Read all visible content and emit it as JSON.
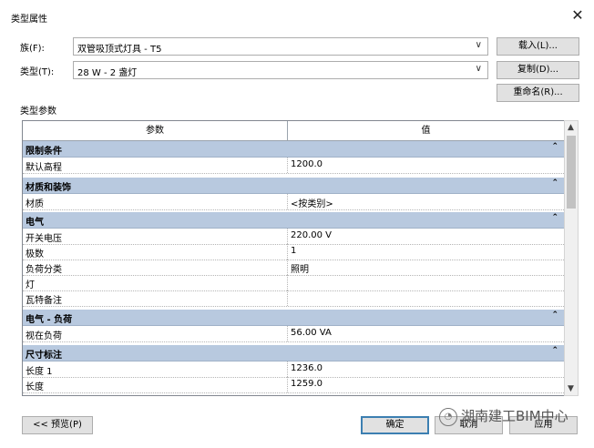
{
  "window": {
    "title": "类型属性",
    "close_glyph": "✕"
  },
  "family": {
    "label": "族(F):",
    "value": "双管吸顶式灯具 - T5",
    "load_button": "载入(L)..."
  },
  "type": {
    "label": "类型(T):",
    "value": "28 W - 2 盏灯",
    "duplicate_button": "复制(D)...",
    "rename_button": "重命名(R)..."
  },
  "section_title": "类型参数",
  "grid": {
    "col_param": "参数",
    "col_value": "值",
    "groups": [
      {
        "name": "限制条件",
        "rows": [
          {
            "param": "默认高程",
            "value": "1200.0"
          }
        ]
      },
      {
        "name": "材质和装饰",
        "rows": [
          {
            "param": "材质",
            "value": "<按类别>"
          }
        ]
      },
      {
        "name": "电气",
        "rows": [
          {
            "param": "开关电压",
            "value": "220.00 V"
          },
          {
            "param": "极数",
            "value": "1"
          },
          {
            "param": "负荷分类",
            "value": "照明"
          },
          {
            "param": "灯",
            "value": ""
          },
          {
            "param": "瓦特备注",
            "value": ""
          }
        ]
      },
      {
        "name": "电气 - 负荷",
        "rows": [
          {
            "param": "视在负荷",
            "value": "56.00 VA"
          }
        ]
      },
      {
        "name": "尺寸标注",
        "rows": [
          {
            "param": "长度 1",
            "value": "1236.0"
          },
          {
            "param": "长度",
            "value": "1259.0"
          }
        ]
      }
    ]
  },
  "footer": {
    "preview_button": "<< 预览(P)",
    "ok_button": "确定",
    "cancel_button": "取消",
    "apply_button": "应用"
  },
  "watermark": "湖南建工BIM中心"
}
